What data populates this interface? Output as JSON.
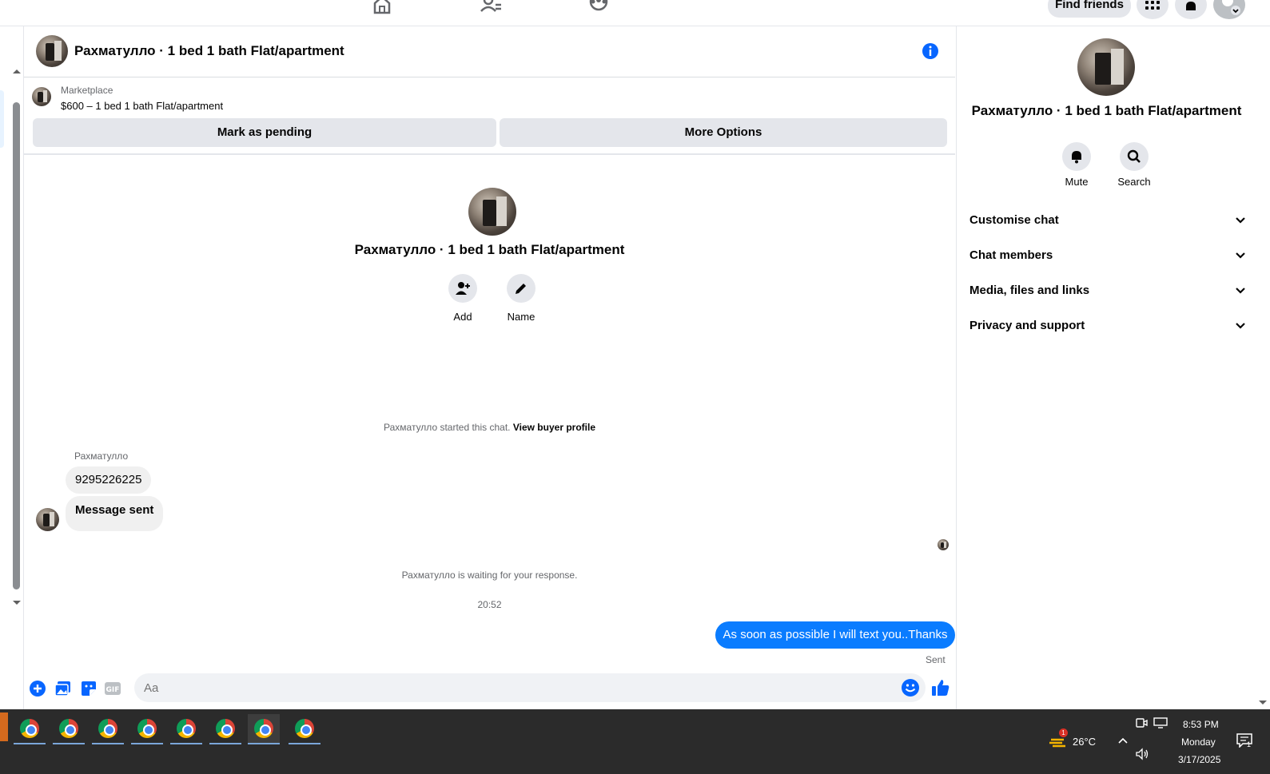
{
  "topbar": {
    "find_friends": "Find friends"
  },
  "chat": {
    "title": "Рахматулло · 1 bed 1 bath Flat/apartment"
  },
  "marketplace": {
    "label": "Marketplace",
    "item": "$600 – 1 bed 1 bath Flat/apartment",
    "pending_btn": "Mark as pending",
    "more_btn": "More Options"
  },
  "conversation": {
    "title": "Рахматулло · 1 bed 1 bath Flat/apartment",
    "add_label": "Add",
    "name_label": "Name",
    "started_text": "Рахматулло started this chat.",
    "view_buyer": "View buyer profile",
    "sender": "Рахматулло",
    "msg1": "9295226225",
    "msg2": "Message sent",
    "waiting": "Рахматулло is waiting for your response.",
    "time": "20:52",
    "outgoing": "As soon as possible I will text you..Thanks",
    "sent_label": "Sent"
  },
  "composer": {
    "placeholder": "Aa"
  },
  "right_panel": {
    "title": "Рахматулло · 1 bed 1 bath Flat/apartment",
    "mute": "Mute",
    "search": "Search",
    "sections": [
      "Customise chat",
      "Chat members",
      "Media, files and links",
      "Privacy and support"
    ]
  },
  "taskbar": {
    "weather_badge": "1",
    "temperature": "26°C",
    "time": "8:53 PM",
    "day": "Monday",
    "date": "3/17/2025",
    "notif_count": "1"
  },
  "colors": {
    "accent": "#0a7cff",
    "info": "#0866ff",
    "gray_btn": "#e4e6eb",
    "taskbar": "#2b2b2b"
  }
}
